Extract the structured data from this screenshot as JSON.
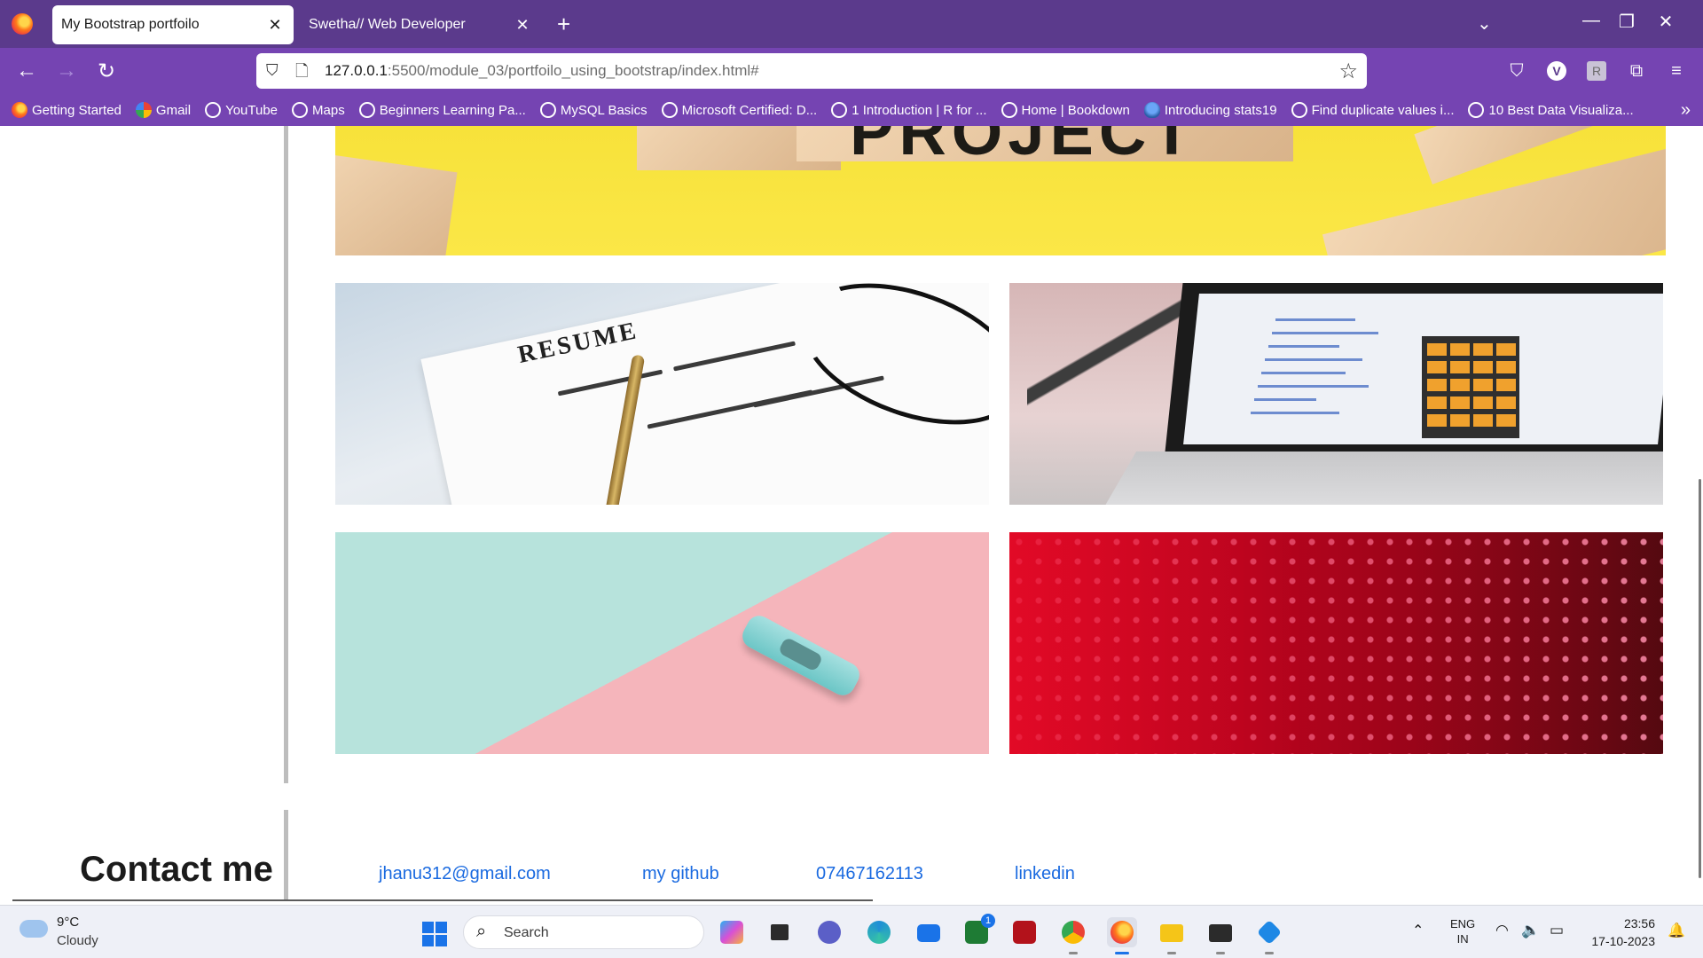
{
  "browser": {
    "tabs": [
      {
        "title": "My Bootstrap portfoilo",
        "active": true
      },
      {
        "title": "Swetha// Web Developer",
        "active": false
      }
    ],
    "new_tab_label": "+",
    "url": {
      "host": "127.0.0.1",
      "rest": ":5500/module_03/portfoilo_using_bootstrap/index.html#"
    },
    "profile_initial": "V",
    "extension_initial": "R",
    "bookmarks": [
      {
        "label": "Getting Started",
        "icon": "firefox-icon"
      },
      {
        "label": "Gmail",
        "icon": "google-icon"
      },
      {
        "label": "YouTube",
        "icon": "globe-icon"
      },
      {
        "label": "Maps",
        "icon": "globe-icon"
      },
      {
        "label": "Beginners Learning Pa...",
        "icon": "globe-icon"
      },
      {
        "label": "MySQL Basics",
        "icon": "globe-icon"
      },
      {
        "label": "Microsoft Certified: D...",
        "icon": "globe-icon"
      },
      {
        "label": "1 Introduction | R for ...",
        "icon": "globe-icon"
      },
      {
        "label": "Home | Bookdown",
        "icon": "globe-icon"
      },
      {
        "label": "Introducing stats19",
        "icon": "bookdown-icon"
      },
      {
        "label": "Find duplicate values i...",
        "icon": "globe-icon"
      },
      {
        "label": "10 Best Data Visualiza...",
        "icon": "globe-icon"
      }
    ]
  },
  "page": {
    "banner_word": "PROJECT",
    "resume_heading": "RESUME",
    "contact": {
      "title": "Contact me",
      "links": [
        {
          "label": "jhanu312@gmail.com"
        },
        {
          "label": "my github"
        },
        {
          "label": "07467162113"
        },
        {
          "label": "linkedin"
        }
      ]
    }
  },
  "taskbar": {
    "weather": {
      "temp": "9°C",
      "condition": "Cloudy"
    },
    "search_placeholder": "Search",
    "language": {
      "line1": "ENG",
      "line2": "IN"
    },
    "clock": {
      "time": "23:56",
      "date": "17-10-2023"
    },
    "mail_badge": "1"
  }
}
